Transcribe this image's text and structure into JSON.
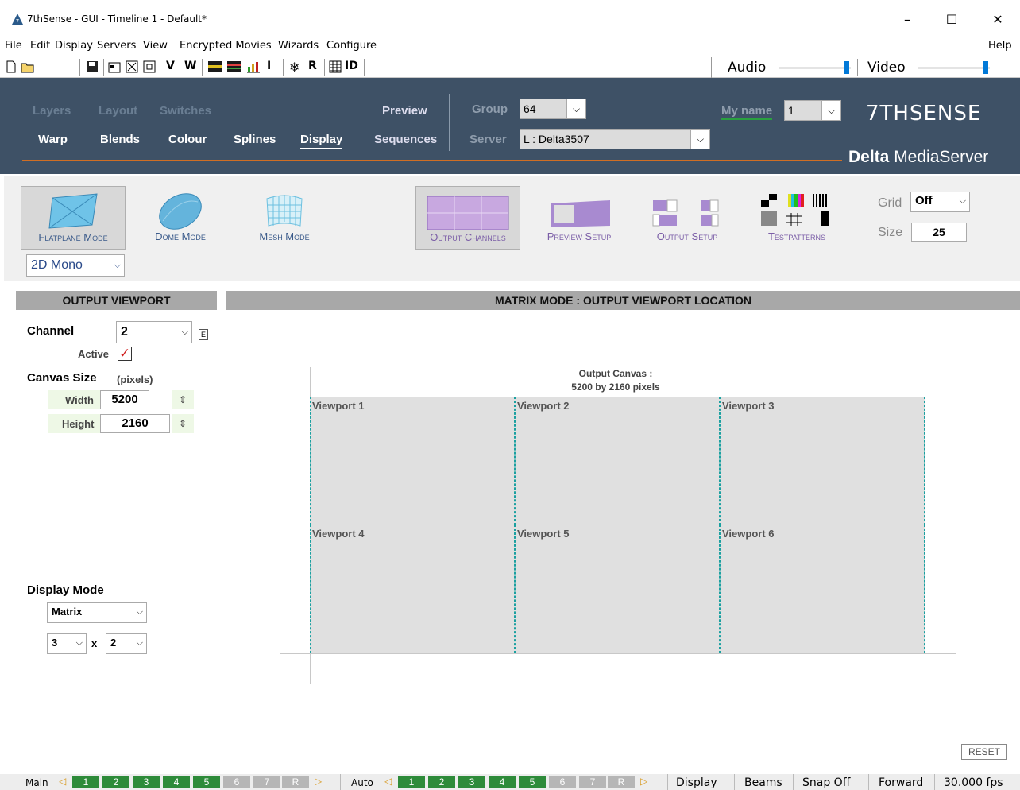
{
  "window": {
    "title": "7thSense -  GUI - Timeline 1 - Default*",
    "minimize": "–",
    "maximize": "☐",
    "close": "✕"
  },
  "menu": {
    "items": [
      "File",
      "Edit",
      "Display",
      "Servers",
      "View",
      "Encrypted Movies",
      "Wizards",
      "Configure"
    ],
    "help": "Help"
  },
  "toolbar": {
    "v": "V",
    "w": "W",
    "i": "I",
    "r": "R",
    "id": "ID",
    "audio": "Audio",
    "video": "Video",
    "audio_level": 0.98,
    "video_level": 0.98
  },
  "nav": {
    "row1": [
      "Layers",
      "Layout",
      "Switches"
    ],
    "row2": [
      "Warp",
      "Blends",
      "Colour",
      "Splines",
      "Display"
    ],
    "preview": "Preview",
    "sequences": "Sequences",
    "group_label": "Group",
    "group_value": "64",
    "server_label": "Server",
    "server_value": "L : Delta3507",
    "myname_label": "My name",
    "myname_value": "1",
    "brand": "7THSENSE",
    "brand_sub_bold": "Delta",
    "brand_sub": " MediaServer"
  },
  "modes": {
    "flatplane": "Flatplane Mode",
    "dome": "Dome Mode",
    "mesh": "Mesh Mode",
    "output_channels": "Output Channels",
    "preview_setup": "Preview Setup",
    "output_setup": "Output Setup",
    "testpatterns": "Testpatterns",
    "grid_label": "Grid",
    "grid_value": "Off",
    "size_label": "Size",
    "size_value": "25",
    "stereo": "2D Mono"
  },
  "left": {
    "header": "OUTPUT VIEWPORT",
    "channel_label": "Channel",
    "channel_value": "2",
    "channel_btn": "E",
    "active_label": "Active",
    "active_check": "✓",
    "canvas_label": "Canvas Size",
    "canvas_unit": "(pixels)",
    "width_label": "Width",
    "width_value": "5200",
    "height_label": "Height",
    "height_value": "2160",
    "display_mode_label": "Display Mode",
    "display_mode_value": "Matrix",
    "cols": "3",
    "x": "x",
    "rows": "2"
  },
  "right": {
    "header": "MATRIX MODE : OUTPUT VIEWPORT LOCATION",
    "canvas_line1": "Output Canvas :",
    "canvas_line2": "5200 by 2160 pixels",
    "viewports": [
      "Viewport 1",
      "Viewport 2",
      "Viewport 3",
      "Viewport 4",
      "Viewport 5",
      "Viewport 6"
    ],
    "reset": "RESET"
  },
  "status": {
    "main": "Main",
    "auto": "Auto",
    "buttons": [
      "1",
      "2",
      "3",
      "4",
      "5",
      "6",
      "7",
      "R"
    ],
    "display": "Display",
    "beams": "Beams",
    "snap": "Snap Off",
    "forward": "Forward",
    "fps": "30.000 fps"
  }
}
